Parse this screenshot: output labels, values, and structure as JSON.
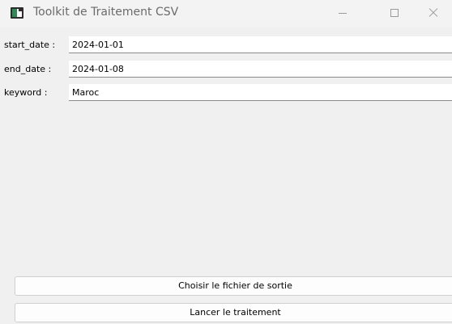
{
  "window": {
    "title": "Toolkit de Traitement CSV",
    "icon": "csv-app-icon"
  },
  "titlebar_controls": {
    "minimize": "minimize-icon",
    "maximize": "maximize-icon",
    "close": "close-icon"
  },
  "form": {
    "start_date": {
      "label": "start_date :",
      "value": "2024-01-01"
    },
    "end_date": {
      "label": "end_date :",
      "value": "2024-01-08"
    },
    "keyword": {
      "label": "keyword :",
      "value": "Maroc"
    }
  },
  "buttons": {
    "choose_output": "Choisir le fichier de sortie",
    "run": "Lancer le traitement"
  }
}
